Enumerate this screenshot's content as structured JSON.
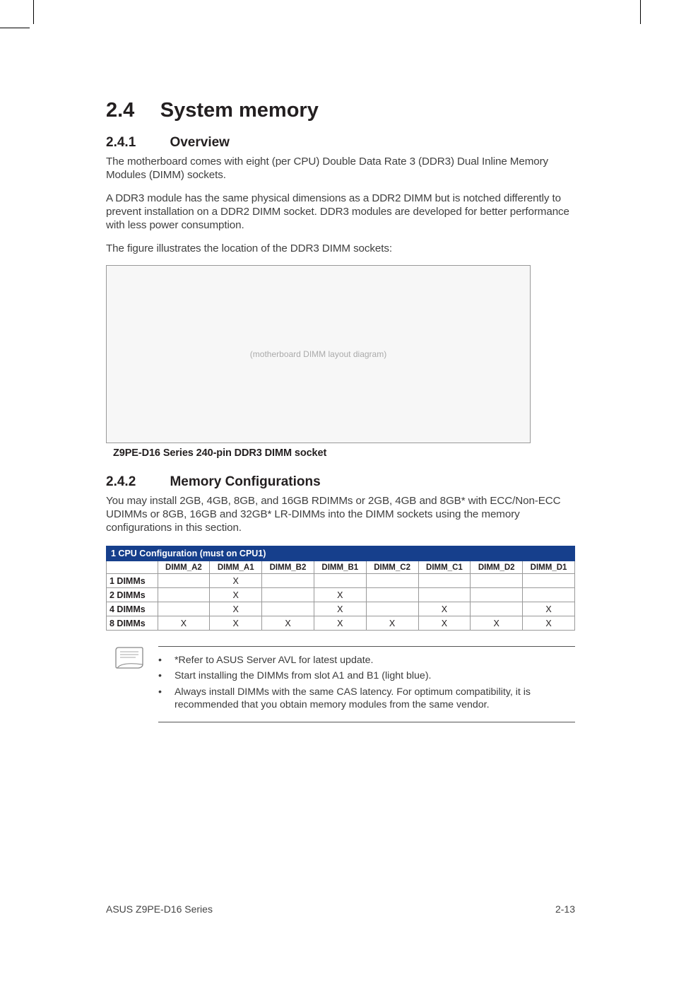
{
  "section": {
    "number": "2.4",
    "title": "System memory"
  },
  "overview": {
    "number": "2.4.1",
    "title": "Overview",
    "p1": "The motherboard comes with eight (per CPU) Double Data Rate 3 (DDR3) Dual Inline Memory Modules (DIMM) sockets.",
    "p2": "A DDR3 module has the same physical dimensions as a DDR2 DIMM but is notched differently to prevent installation on a DDR2 DIMM socket. DDR3 modules are developed for better performance with less power consumption.",
    "p3": "The figure illustrates the location of the DDR3 DIMM sockets:"
  },
  "figure": {
    "caption": "Z9PE-D16 Series 240-pin DDR3 DIMM socket"
  },
  "memconfig": {
    "number": "2.4.2",
    "title": "Memory Configurations",
    "p1": "You may install 2GB, 4GB, 8GB, and 16GB RDIMMs or 2GB, 4GB and 8GB* with ECC/Non-ECC UDIMMs or 8GB, 16GB and 32GB* LR-DIMMs into the DIMM sockets using the memory configurations in this section."
  },
  "table": {
    "banner": "1 CPU Configuration (must on CPU1)",
    "columns": [
      "DIMM_A2",
      "DIMM_A1",
      "DIMM_B2",
      "DIMM_B1",
      "DIMM_C2",
      "DIMM_C1",
      "DIMM_D2",
      "DIMM_D1"
    ],
    "rows": [
      {
        "label": "1 DIMMs",
        "cells": [
          "",
          "X",
          "",
          "",
          "",
          "",
          "",
          ""
        ]
      },
      {
        "label": "2 DIMMs",
        "cells": [
          "",
          "X",
          "",
          "X",
          "",
          "",
          "",
          ""
        ]
      },
      {
        "label": "4 DIMMs",
        "cells": [
          "",
          "X",
          "",
          "X",
          "",
          "X",
          "",
          "X"
        ]
      },
      {
        "label": "8 DIMMs",
        "cells": [
          "X",
          "X",
          "X",
          "X",
          "X",
          "X",
          "X",
          "X"
        ]
      }
    ]
  },
  "notes": {
    "items": [
      "*Refer to ASUS Server AVL for latest update.",
      "Start installing the DIMMs from slot A1 and B1 (light blue).",
      "Always install DIMMs with the same CAS latency. For optimum compatibility, it is recommended that you obtain memory modules from the same vendor."
    ]
  },
  "footer": {
    "left": "ASUS Z9PE-D16 Series",
    "right": "2-13"
  }
}
